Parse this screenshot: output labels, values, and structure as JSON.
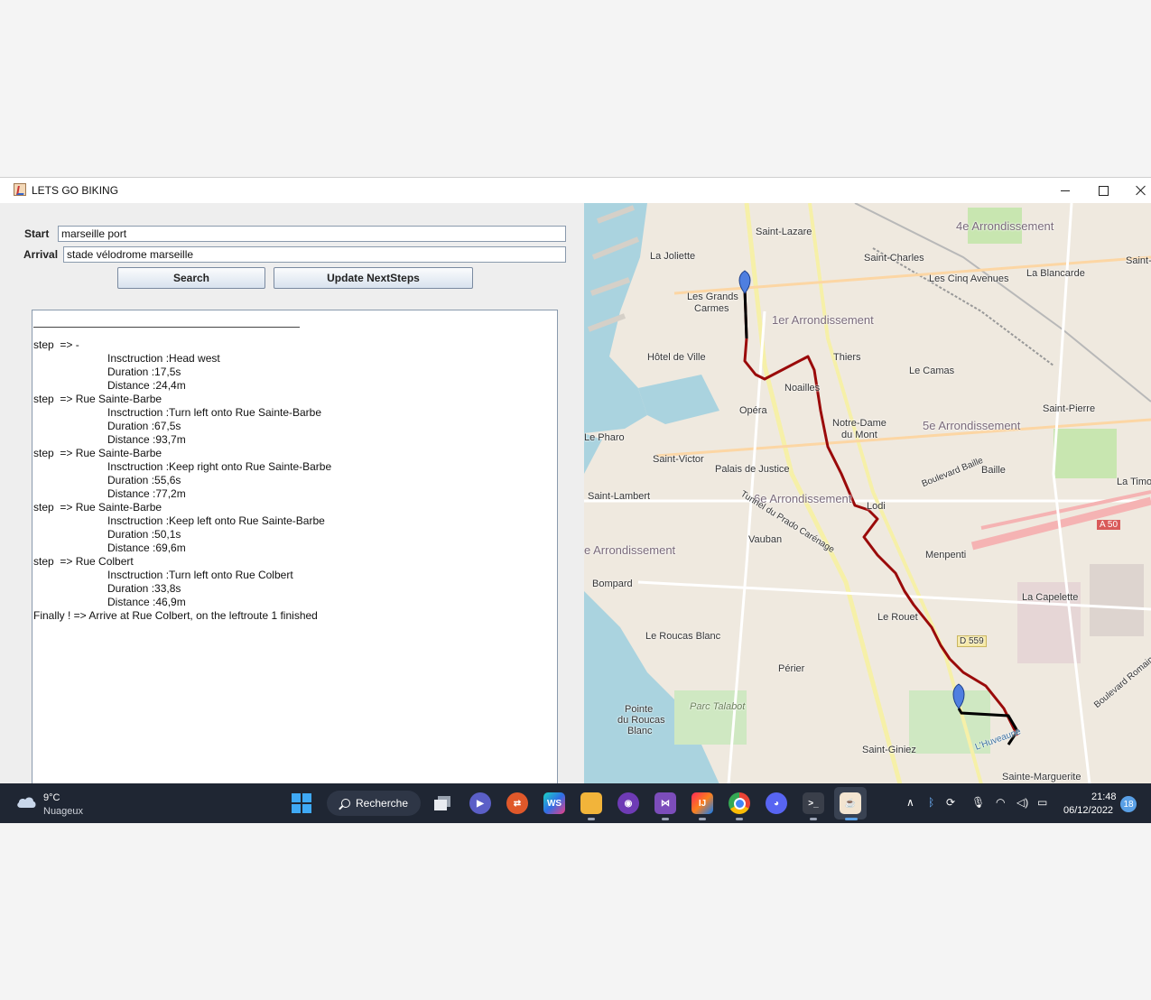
{
  "window": {
    "title": "LETS GO BIKING"
  },
  "form": {
    "start_label": "Start",
    "start_value": "marseille port",
    "arrival_label": "Arrival",
    "arrival_value": "stade vélodrome marseille",
    "search_label": "Search",
    "update_label": "Update NextSteps"
  },
  "output": {
    "lines": [
      {
        "text": "step  => -",
        "indent": false
      },
      {
        "text": "Insctruction :Head west",
        "indent": true
      },
      {
        "text": "Duration :17,5s",
        "indent": true
      },
      {
        "text": "Distance :24,4m",
        "indent": true
      },
      {
        "text": "step  => Rue Sainte-Barbe",
        "indent": false
      },
      {
        "text": "Insctruction :Turn left onto Rue Sainte-Barbe",
        "indent": true
      },
      {
        "text": "Duration :67,5s",
        "indent": true
      },
      {
        "text": "Distance :93,7m",
        "indent": true
      },
      {
        "text": "step  => Rue Sainte-Barbe",
        "indent": false
      },
      {
        "text": "Insctruction :Keep right onto Rue Sainte-Barbe",
        "indent": true
      },
      {
        "text": "Duration :55,6s",
        "indent": true
      },
      {
        "text": "Distance :77,2m",
        "indent": true
      },
      {
        "text": "step  => Rue Sainte-Barbe",
        "indent": false
      },
      {
        "text": "Insctruction :Keep left onto Rue Sainte-Barbe",
        "indent": true
      },
      {
        "text": "Duration :50,1s",
        "indent": true
      },
      {
        "text": "Distance :69,6m",
        "indent": true
      },
      {
        "text": "step  => Rue Colbert",
        "indent": false
      },
      {
        "text": "Insctruction :Turn left onto Rue Colbert",
        "indent": true
      },
      {
        "text": "Duration :33,8s",
        "indent": true
      },
      {
        "text": "Distance :46,9m",
        "indent": true
      },
      {
        "text": "Finally ! => Arrive at Rue Colbert, on the leftroute 1 finished",
        "indent": false
      }
    ]
  },
  "map": {
    "labels": {
      "saint_lazare": "Saint-Lazare",
      "arr4": "4e Arrondissement",
      "saint_charles": "Saint-Charles",
      "saint_short": "Saint-",
      "la_joliette": "La Joliette",
      "les_cinq_avenues": "Les Cinq Avenues",
      "la_blancarde": "La Blancarde",
      "les_grands_carmes_1": "Les Grands",
      "les_grands_carmes_2": "Carmes",
      "arr1": "1er Arrondissement",
      "hotel_de_ville": "Hôtel de Ville",
      "thiers": "Thiers",
      "le_camas": "Le Camas",
      "noailles": "Noailles",
      "opera": "Opéra",
      "notre_dame_1": "Notre-Dame",
      "notre_dame_2": "du Mont",
      "saint_pierre": "Saint-Pierre",
      "arr5": "5e Arrondissement",
      "le_pharo": "Le Pharo",
      "saint_victor": "Saint-Victor",
      "palais_de_justice": "Palais de Justice",
      "baille": "Baille",
      "la_timone": "La Timo",
      "saint_lambert": "Saint-Lambert",
      "arr6": "6e Arrondissement",
      "lodi": "Lodi",
      "vauban": "Vauban",
      "arr7": "e Arrondissement",
      "menpenti": "Menpenti",
      "bompard": "Bompard",
      "la_capelette": "La Capelette",
      "le_rouet": "Le Rouet",
      "d559": "D 559",
      "a50": "A 50",
      "le_roucas_blanc": "Le Roucas Blanc",
      "perier": "Périer",
      "pointe_1": "Pointe",
      "pointe_2": "du Roucas",
      "pointe_3": "Blanc",
      "parc_talabot": "Parc Talabot",
      "saint_giniez": "Saint-Giniez",
      "sainte_marguerite": "Sainte-Marguerite",
      "boulevard_baille": "Boulevard Baille",
      "tunnel_prado": "Tunnel du Prado Carénage",
      "huveaune": "L'Huveaune",
      "bd_romain": "Boulevard Romain Rol"
    }
  },
  "taskbar": {
    "weather_temp": "9°C",
    "weather_desc": "Nuageux",
    "search_label": "Recherche",
    "time": "21:48",
    "date": "06/12/2022",
    "notifications": "18",
    "icons": [
      "windows-start-icon",
      "search-icon",
      "task-view-icon",
      "teams-chat-icon",
      "git-remote-icon",
      "webstorm-icon",
      "file-explorer-icon",
      "github-desktop-icon",
      "visual-studio-icon",
      "intellij-icon",
      "chrome-icon",
      "discord-icon",
      "terminal-icon",
      "java-app-icon"
    ],
    "colors": {
      "taskbar": "#1f2633",
      "accent": "#5aa0e6"
    }
  },
  "route": {
    "colors": {
      "route": "#9a0a0a",
      "marker": "#4f7fe0"
    }
  }
}
